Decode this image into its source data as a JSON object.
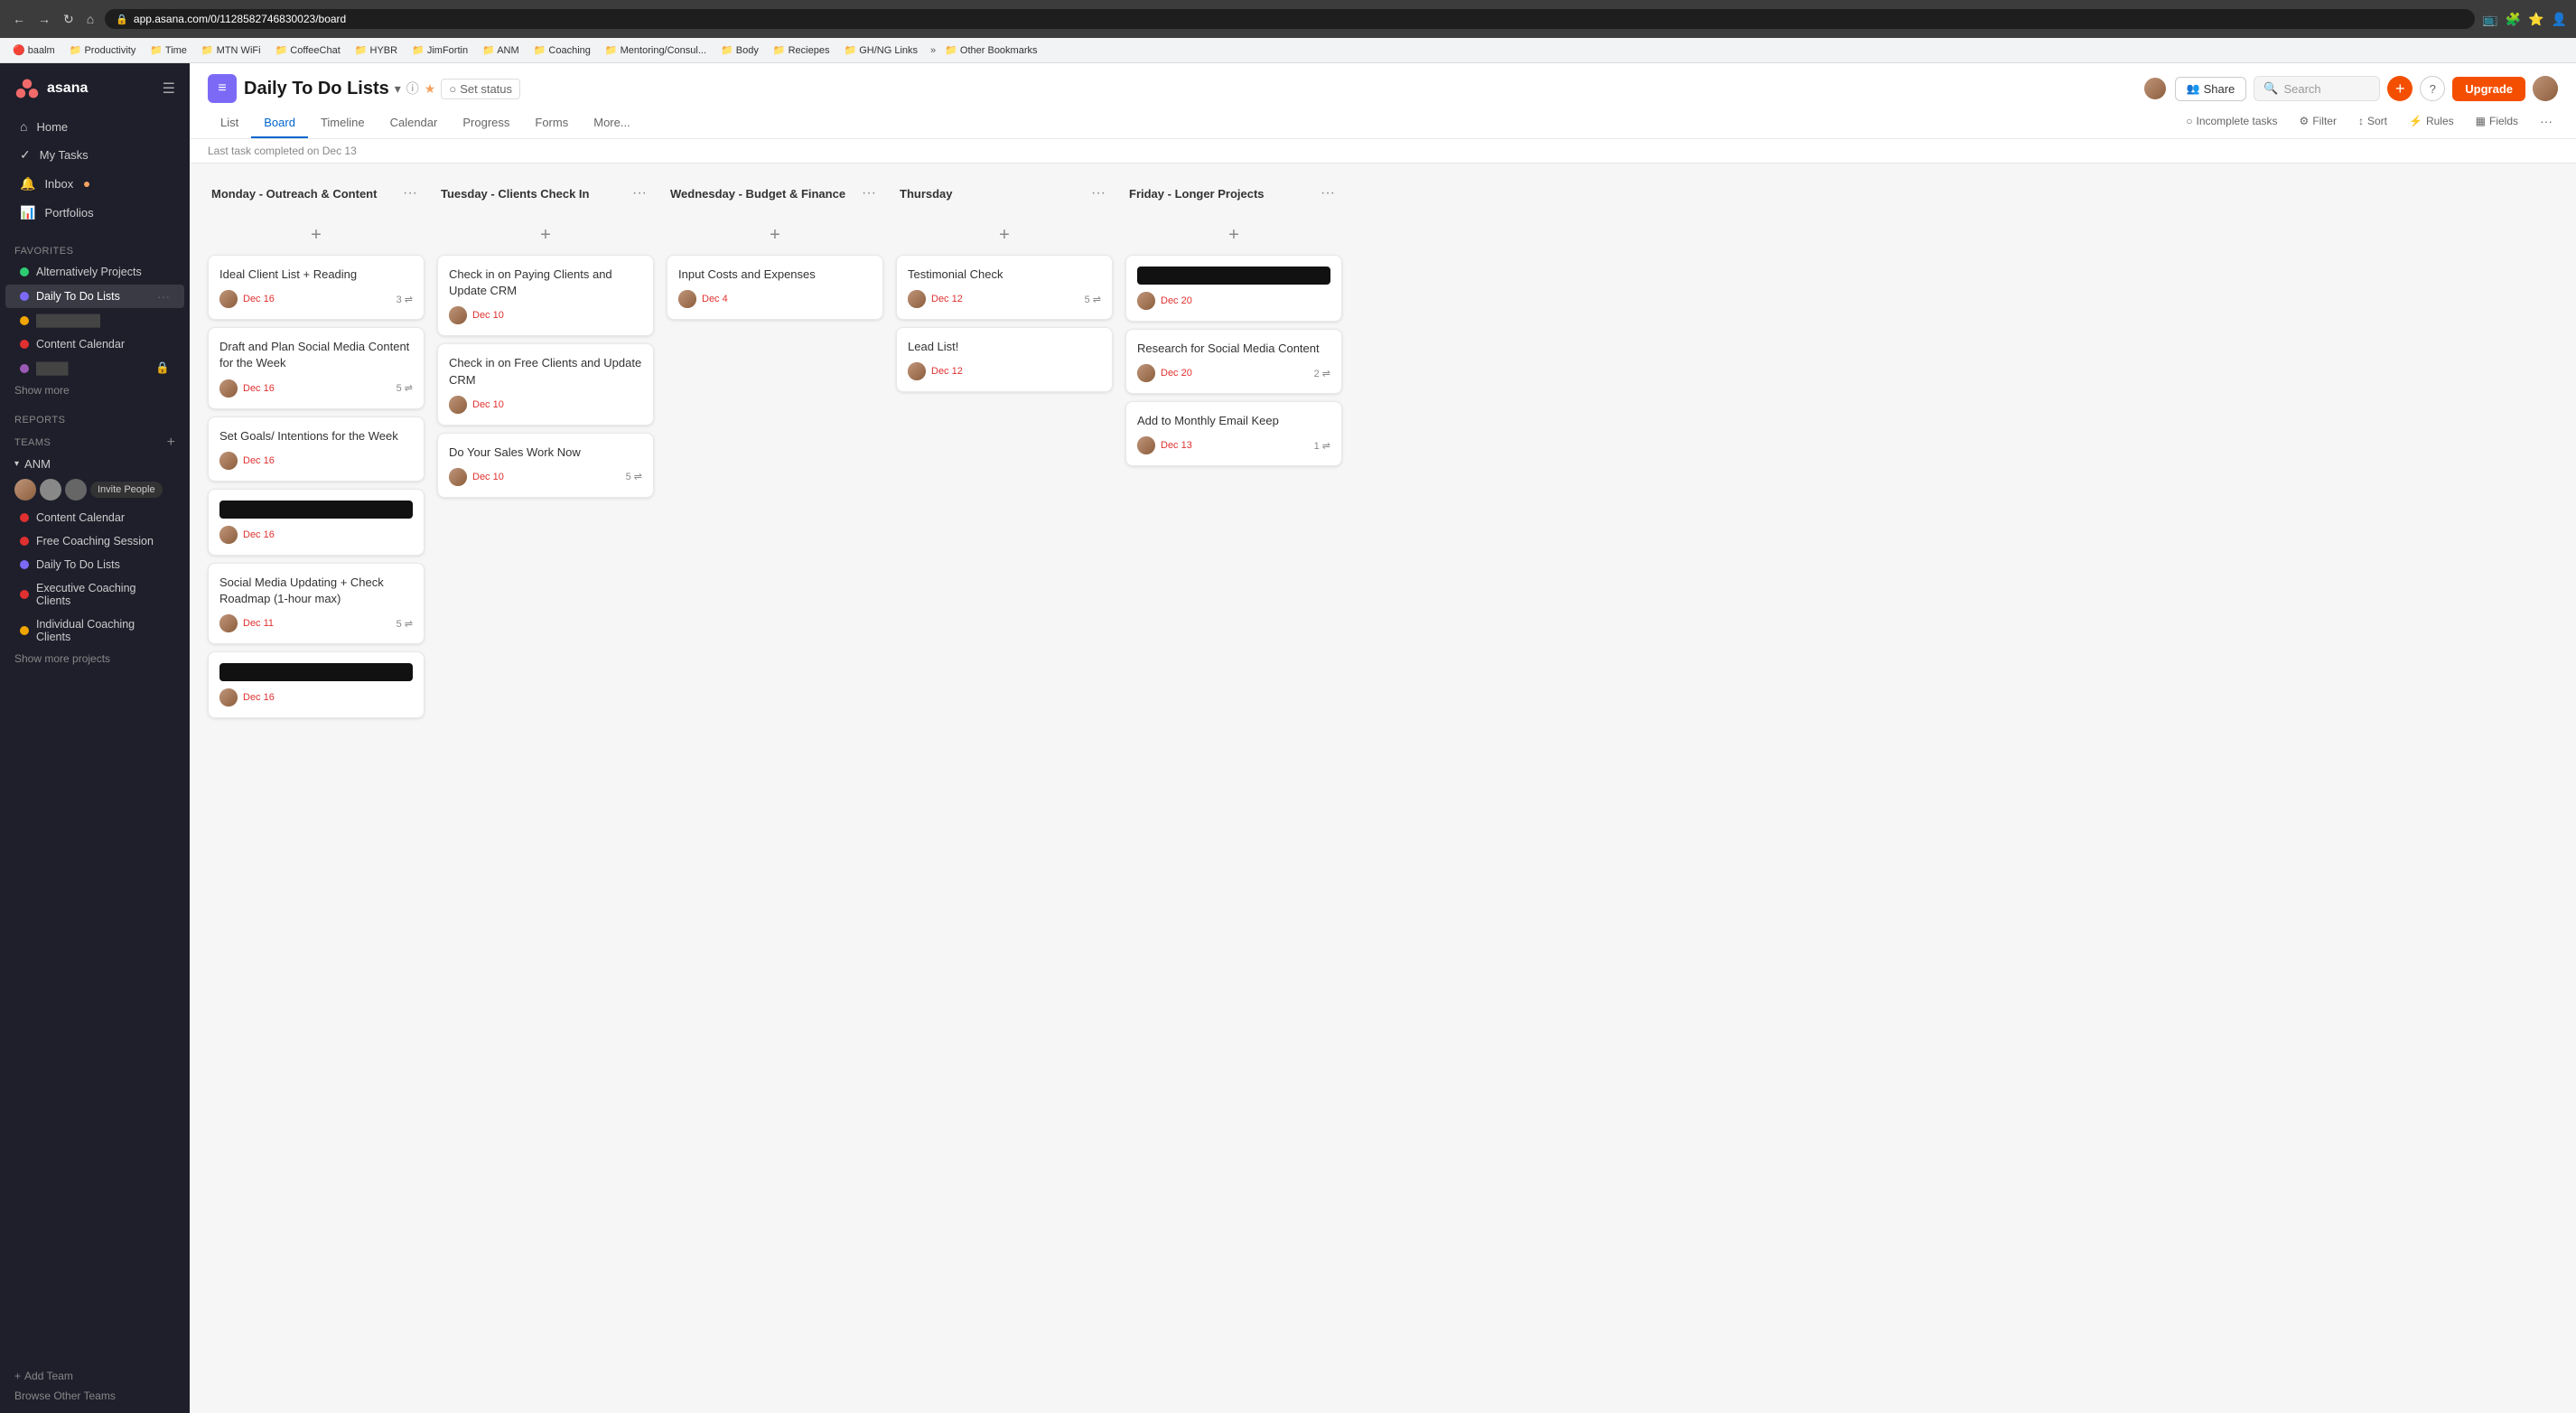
{
  "browser": {
    "url": "app.asana.com/0/1128582746830023/board",
    "back_btn": "←",
    "forward_btn": "→",
    "refresh_btn": "↺",
    "home_btn": "⌂"
  },
  "bookmarks": [
    {
      "label": "baalm",
      "icon": "🔴"
    },
    {
      "label": "Productivity",
      "icon": "📁"
    },
    {
      "label": "Time",
      "icon": "📁"
    },
    {
      "label": "MTN WiFi",
      "icon": "📁"
    },
    {
      "label": "CoffeeChat",
      "icon": "📁"
    },
    {
      "label": "HYBR",
      "icon": "📁"
    },
    {
      "label": "JimFortin",
      "icon": "📁"
    },
    {
      "label": "ANM",
      "icon": "📁"
    },
    {
      "label": "Coaching",
      "icon": "📁"
    },
    {
      "label": "Mentoring/Consul...",
      "icon": "📁"
    },
    {
      "label": "Body",
      "icon": "📁"
    },
    {
      "label": "Reciepes",
      "icon": "📁"
    },
    {
      "label": "GH/NG Links",
      "icon": "📁"
    },
    {
      "label": "»",
      "icon": ""
    },
    {
      "label": "Other Bookmarks",
      "icon": "📁"
    }
  ],
  "sidebar": {
    "nav_items": [
      {
        "label": "Home",
        "icon": "⌂"
      },
      {
        "label": "My Tasks",
        "icon": "✓"
      },
      {
        "label": "Inbox",
        "icon": "🔔",
        "badge": true
      },
      {
        "label": "Portfolios",
        "icon": "📊"
      }
    ],
    "favorites_label": "Favorites",
    "favorites": [
      {
        "label": "Alternatively Projects",
        "color": "#2ecc71",
        "active": false
      },
      {
        "label": "Daily To Do Lists",
        "color": "#7c6af7",
        "active": true
      },
      {
        "label": "",
        "color": "#f0a500",
        "redacted": true
      },
      {
        "label": "Content Calendar",
        "color": "#e03030",
        "active": false
      },
      {
        "label": "",
        "color": "#9b59b6",
        "redacted": true,
        "lock": true
      }
    ],
    "show_more": "Show more",
    "reports_label": "Reports",
    "teams_label": "Teams",
    "team_name": "ANM",
    "invite_btn": "Invite People",
    "team_projects": [
      {
        "label": "Content Calendar",
        "color": "#e03030"
      },
      {
        "label": "Free Coaching Session",
        "color": "#e03030"
      },
      {
        "label": "Daily To Do Lists",
        "color": "#7c6af7"
      },
      {
        "label": "Executive Coaching Clients",
        "color": "#e03030"
      },
      {
        "label": "Individual Coaching Clients",
        "color": "#f0a500"
      }
    ],
    "show_more_projects": "Show more projects",
    "add_team": "+ Add Team",
    "browse_teams": "Browse Other Teams"
  },
  "project": {
    "title": "Daily To Do Lists",
    "icon": "≡",
    "tabs": [
      "List",
      "Board",
      "Timeline",
      "Calendar",
      "Progress",
      "Forms",
      "More..."
    ],
    "active_tab": "Board",
    "status_label": "Set status",
    "last_task_text": "Last task completed on Dec 13",
    "share_label": "Share",
    "search_placeholder": "Search",
    "upgrade_label": "Upgrade",
    "toolbar": {
      "incomplete_tasks": "Incomplete tasks",
      "filter": "Filter",
      "sort": "Sort",
      "rules": "Rules",
      "fields": "Fields"
    }
  },
  "columns": [
    {
      "title": "Monday - Outreach & Content",
      "cards": [
        {
          "title": "Ideal Client List + Reading",
          "date": "Dec 16",
          "count": "3",
          "avatar": true
        },
        {
          "title": "Draft and Plan Social Media Content for the Week",
          "date": "Dec 16",
          "count": "5",
          "avatar": true
        },
        {
          "title": "Set Goals/ Intentions for the Week",
          "date": "Dec 16",
          "count": null,
          "avatar": true
        },
        {
          "title": null,
          "date": "Dec 16",
          "count": null,
          "avatar": true,
          "redacted": true
        },
        {
          "title": "Social Media Updating + Check Roadmap (1-hour max)",
          "date": "Dec 11",
          "count": "5",
          "avatar": true
        },
        {
          "title": null,
          "date": "Dec 16",
          "count": null,
          "avatar": true,
          "redacted": true
        }
      ]
    },
    {
      "title": "Tuesday - Clients Check In",
      "cards": [
        {
          "title": "Check in on Paying Clients and Update CRM",
          "date": "Dec 10",
          "count": null,
          "avatar": true
        },
        {
          "title": "Check in on Free Clients and Update CRM",
          "date": "Dec 10",
          "count": null,
          "avatar": true
        },
        {
          "title": "Do Your Sales Work Now",
          "date": "Dec 10",
          "count": "5",
          "avatar": true
        }
      ]
    },
    {
      "title": "Wednesday - Budget & Finance",
      "cards": [
        {
          "title": "Input Costs and Expenses",
          "date": "Dec 4",
          "count": null,
          "avatar": true
        }
      ]
    },
    {
      "title": "Thursday",
      "cards": [
        {
          "title": "Testimonial Check",
          "date": "Dec 12",
          "count": "5",
          "avatar": true
        },
        {
          "title": "Lead List!",
          "date": "Dec 12",
          "count": null,
          "avatar": true
        }
      ]
    },
    {
      "title": "Friday - Longer Projects",
      "cards": [
        {
          "title": null,
          "date": "Dec 20",
          "count": null,
          "avatar": true,
          "redacted": true
        },
        {
          "title": "Research for Social Media Content",
          "date": "Dec 20",
          "count": "2",
          "avatar": true
        },
        {
          "title": "Add to Monthly Email Keep",
          "date": "Dec 13",
          "count": "1",
          "avatar": true
        }
      ]
    }
  ]
}
